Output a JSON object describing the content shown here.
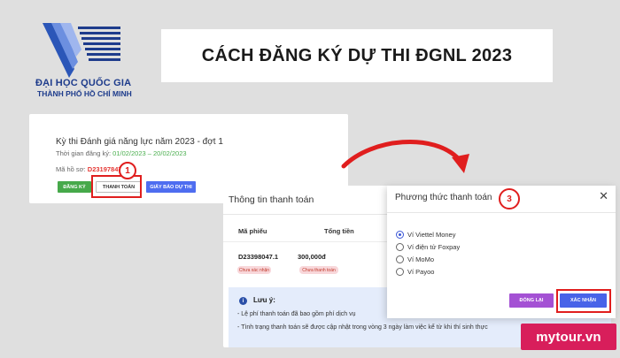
{
  "logo": {
    "line1": "ĐẠI HỌC QUỐC GIA",
    "line2": "THÀNH PHỐ HỒ CHÍ MINH",
    "brand_color": "#1e3c8c"
  },
  "banner": {
    "title": "CÁCH ĐĂNG KÝ DỰ THI ĐGNL 2023"
  },
  "step1": {
    "badge": "1",
    "exam_title": "Kỳ thi Đánh giá năng lực năm 2023 - đợt 1",
    "time_label": "Thời gian đăng ký:",
    "time_value": "01/02/2023 – 20/02/2023",
    "code_label": "Mã hồ sơ:",
    "code_value": "D23197847",
    "buttons": {
      "register": "ĐĂNG KÝ",
      "pay": "THANH TOÁN",
      "notice": "GIẤY BÁO DỰ THI"
    }
  },
  "payment_info": {
    "heading": "Thông tin thanh toán",
    "columns": [
      "Mã phiếu",
      "Tổng tiền"
    ],
    "row": {
      "code": "D23398047.1",
      "amount": "300,000đ",
      "status1": "Chưa xác nhận",
      "status2": "Chưa thanh toán"
    },
    "note": {
      "title": "Lưu ý:",
      "line1": "- Lệ phí thanh toán đã bao gồm phí dịch vụ",
      "line2": "- Tình trạng thanh toán sẽ được cập nhật trong vòng 3 ngày làm việc kể từ khi thí sinh thực"
    }
  },
  "modal": {
    "badge": "3",
    "heading": "Phương thức thanh toán",
    "close": "✕",
    "options": [
      "Ví Viettel Money",
      "Ví điện tử Foxpay",
      "Ví MoMo",
      "Ví Payoo"
    ],
    "selected_index": 0,
    "back_label": "ĐÓNG LẠI",
    "confirm_label": "XÁC NHẬN"
  },
  "watermark": {
    "text": "mytour.vn"
  },
  "colors": {
    "highlight": "#e01e1e",
    "register": "#46a94a",
    "notice": "#4e6df0",
    "confirm": "#4863e8",
    "back": "#a451d4",
    "watermark": "#d81e5b"
  }
}
